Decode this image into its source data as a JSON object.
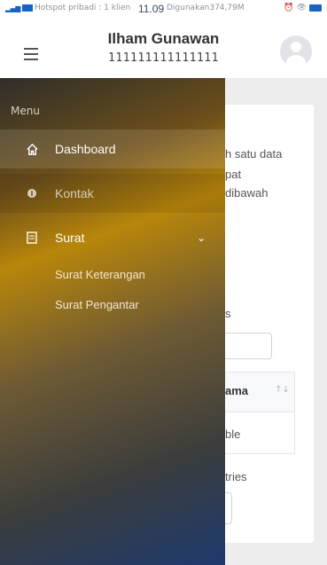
{
  "status_bar": {
    "left_text": "Hotspot pribadi : 1 klien",
    "time": "11.09",
    "right_text": "Digunakan374,79M",
    "accent": "#1a63c4"
  },
  "header": {
    "user_name": "Ilham Gunawan",
    "user_id": "111111111111111",
    "menu_icon": "hamburger-icon",
    "avatar_icon": "user-avatar-icon"
  },
  "sidebar": {
    "title": "Menu",
    "items": [
      {
        "label": "Dashboard",
        "icon": "home-icon"
      },
      {
        "label": "Kontak",
        "icon": "contact-icon"
      },
      {
        "label": "Surat",
        "icon": "document-icon"
      }
    ],
    "submenu": [
      {
        "label": "Surat Keterangan"
      },
      {
        "label": "Surat Pengantar"
      }
    ]
  },
  "background_content": {
    "line1": "h satu data",
    "line2": "pat",
    "line3": "dibawah",
    "entries_label": "s",
    "col_header": "ama",
    "row_text": "ble",
    "entries_text": "tries"
  }
}
